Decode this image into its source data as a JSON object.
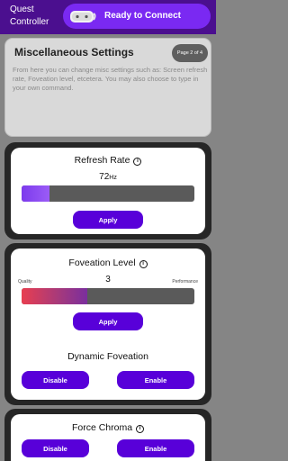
{
  "header": {
    "app_title": "Quest Controller",
    "status_label": "Ready to Connect"
  },
  "info": {
    "title": "Miscellaneous Settings",
    "page_badge": "Page 2 of 4",
    "description": "From here you can change misc settings such as: Screen refresh rate, Foveation level, etcetera. You may also choose to type in your own command."
  },
  "refresh": {
    "title": "Refresh Rate",
    "value": "72",
    "unit": "Hz",
    "slider_fraction": 0.16,
    "apply_label": "Apply"
  },
  "foveation": {
    "title": "Foveation Level",
    "value": "3",
    "left_label": "Quality",
    "right_label": "Performance",
    "slider_fraction": 0.38,
    "apply_label": "Apply"
  },
  "dynamic_foveation": {
    "title": "Dynamic Foveation",
    "disable_label": "Disable",
    "enable_label": "Enable"
  },
  "force_chroma": {
    "title": "Force Chroma",
    "disable_label": "Disable",
    "enable_label": "Enable"
  },
  "colors": {
    "header_bg": "#4b0f8f",
    "pill_bg": "#7a29f2",
    "button": "#5800d9",
    "panel_bg": "#262626"
  },
  "icons": {
    "headset": "vr-headset-icon",
    "info": "info-icon"
  }
}
